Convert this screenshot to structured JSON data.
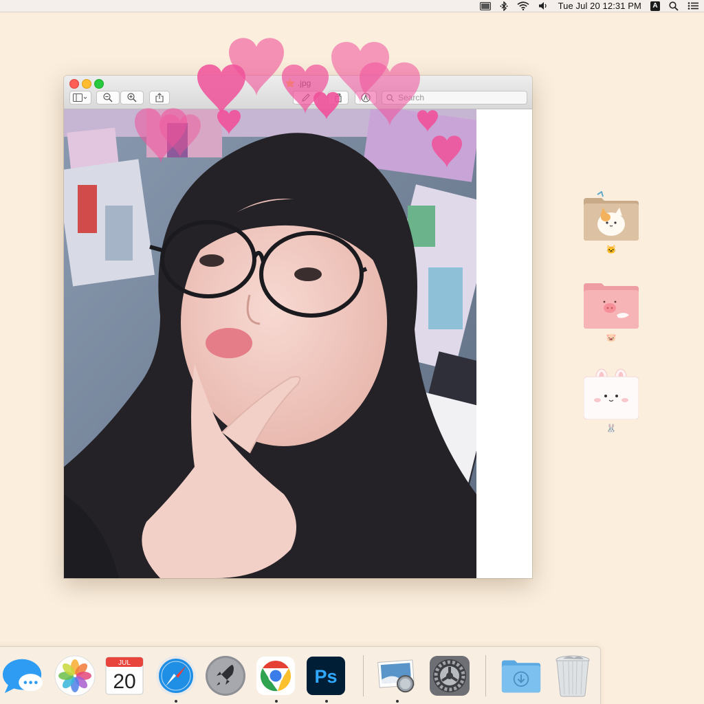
{
  "menubar": {
    "clock": "Tue Jul 20  12:31 PM",
    "input_source": "A",
    "icons": [
      "display-icon",
      "bluetooth-icon",
      "wifi-icon",
      "volume-icon",
      "spotlight-search-icon",
      "control-center-icon"
    ]
  },
  "window": {
    "app": "Preview",
    "title": "⭐ .jpg",
    "toolbar": {
      "buttons": [
        "sidebar-toggle",
        "zoom-out",
        "zoom-in",
        "share",
        "markup-pen",
        "rotate",
        "annotate"
      ],
      "search_placeholder": "Search"
    },
    "image": {
      "subject": "selfie photo with heart stickers",
      "heart_color": "#f0519a"
    }
  },
  "desktop": {
    "folders": [
      {
        "label": "🐱",
        "style": "cat"
      },
      {
        "label": "🐷",
        "style": "pig"
      },
      {
        "label": "🐰",
        "style": "bunny"
      }
    ]
  },
  "dock": {
    "apps": [
      {
        "name": "Messages",
        "running": false
      },
      {
        "name": "Photos",
        "running": false
      },
      {
        "name": "Calendar",
        "running": false,
        "month": "JUL",
        "day": "20"
      },
      {
        "name": "Safari",
        "running": true
      },
      {
        "name": "Launchpad",
        "running": false
      },
      {
        "name": "Google Chrome",
        "running": true
      },
      {
        "name": "Photoshop",
        "running": true,
        "label": "Ps"
      },
      {
        "name": "Preview",
        "running": true
      },
      {
        "name": "System Preferences",
        "running": false
      },
      {
        "name": "Downloads",
        "running": false
      },
      {
        "name": "Trash",
        "running": false
      }
    ]
  },
  "colors": {
    "desktop_bg": "#fbeedd",
    "accent_pink": "#f0519a"
  }
}
